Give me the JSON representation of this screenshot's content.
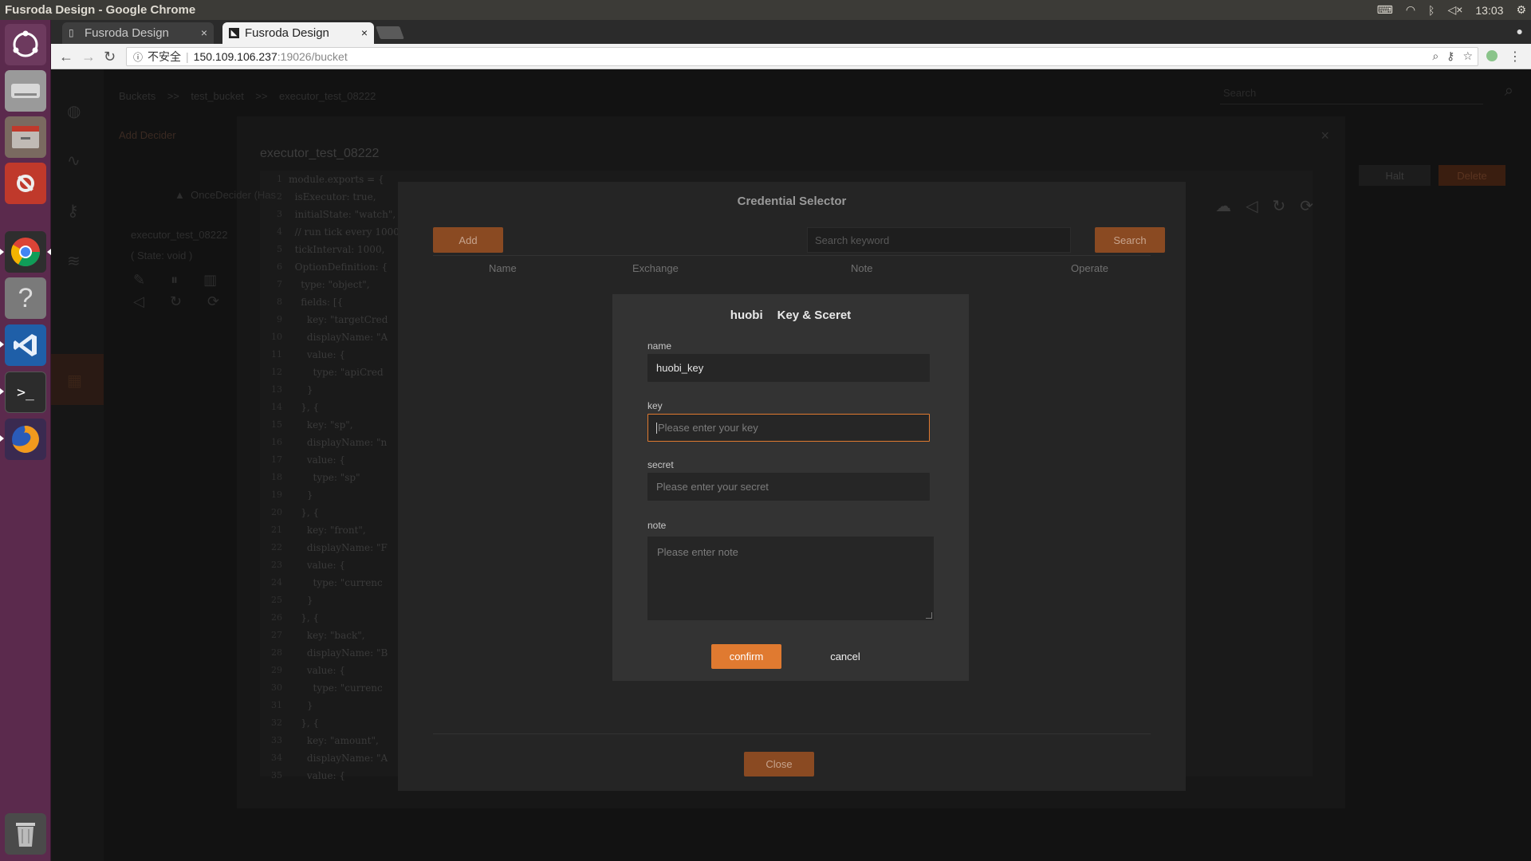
{
  "os": {
    "window_title": "Fusroda Design - Google Chrome",
    "clock": "13:03"
  },
  "browser": {
    "tabs": [
      {
        "label": "Fusroda Design"
      },
      {
        "label": "Fusroda Design"
      }
    ],
    "security_label": "不安全",
    "url_host": "150.109.106.237",
    "url_path": ":19026/bucket"
  },
  "background": {
    "breadcrumb": [
      "Buckets",
      ">>",
      "test_bucket",
      ">>",
      "executor_test_08222"
    ],
    "add_decider": "Add Decider",
    "search_placeholder": "Search",
    "modal_title": "executor_test_08222",
    "decider_label": "OnceDecider (Has",
    "decider_name": "executor_test_08222",
    "decider_state": "( State: void )",
    "halt_label": "Halt",
    "delete_label": "Delete",
    "code_lines": [
      "module.exports = {",
      "  isExecutor: true,",
      "  initialState: \"watch\",",
      "  // run tick every 1000",
      "  tickInterval: 1000,",
      "  OptionDefinition: {",
      "    type: \"object\",",
      "    fields: [{",
      "      key: \"targetCred",
      "      displayName: \"A",
      "      value: {",
      "        type: \"apiCred",
      "      }",
      "    }, {",
      "      key: \"sp\",",
      "      displayName: \"n",
      "      value: {",
      "        type: \"sp\"",
      "      }",
      "    }, {",
      "      key: \"front\",",
      "      displayName: \"F",
      "      value: {",
      "        type: \"currenc",
      "      }",
      "    }, {",
      "      key: \"back\",",
      "      displayName: \"B",
      "      value: {",
      "        type: \"currenc",
      "      }",
      "    }, {",
      "      key: \"amount\",",
      "      displayName: \"A",
      "      value: {"
    ]
  },
  "credential_selector": {
    "title": "Credential Selector",
    "add_label": "Add",
    "search_placeholder": "Search keyword",
    "search_label": "Search",
    "columns": [
      "Name",
      "Exchange",
      "Note",
      "Operate"
    ],
    "close_label": "Close"
  },
  "dialog": {
    "exchange": "huobi",
    "title": "Key & Sceret",
    "name_label": "name",
    "name_value": "huobi_key",
    "key_label": "key",
    "key_placeholder": "Please enter your key",
    "secret_label": "secret",
    "secret_placeholder": "Please enter your secret",
    "note_label": "note",
    "note_placeholder": "Please enter note",
    "confirm_label": "confirm",
    "cancel_label": "cancel"
  },
  "colors": {
    "accent": "#e07a30",
    "dialog_bg": "#333333",
    "launcher": "#5b2a4d"
  }
}
